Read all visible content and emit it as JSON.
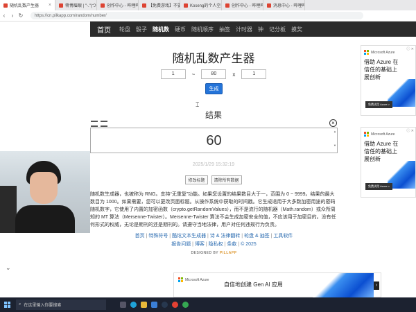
{
  "browser": {
    "tabs": [
      {
        "label": "随机乱数产生器",
        "active": true
      },
      {
        "label": "蒋博眉眼 | \"-.\"(つ`□´)~ 干杯~-bili",
        "active": false
      },
      {
        "label": "创作中心 - 哔哩哔哩弹幕视频网",
        "active": false
      },
      {
        "label": "【免费游戏】不要超过人类所有…",
        "active": false
      },
      {
        "label": "Koseng的个人空间-Koseng个人…",
        "active": false
      },
      {
        "label": "创作中心 - 哔哩哔哩弹幕视频网",
        "active": false
      },
      {
        "label": "消息中心 - 哔哩哔哩弹幕视频网",
        "active": false
      }
    ],
    "url": "https://cn.pilkapp.com/random/number/"
  },
  "nav": {
    "home": "首页",
    "items": [
      "轮盘",
      "骰子",
      "随机数",
      "硬币",
      "随机顺序",
      "抽签",
      "计时器",
      "钟",
      "记分板",
      "摸奖"
    ],
    "current": "随机数"
  },
  "main": {
    "title": "随机乱数产生器",
    "min": "1",
    "dash": "~",
    "max": "80",
    "times": "x",
    "count": "1",
    "generate_label": "生成",
    "result_title": "结果",
    "result_value": "60",
    "timestamp": "2025/1/29 15:32:19",
    "btn_edit": "修改标题",
    "btn_clear": "清除所有数据",
    "description": "随机数生成器，也被称为 RNG。支持“无重复”功能。如果您设置的结果数目大于一，范围为 0 ~ 9999。结果的最大数目为 1000。如果需要，您可以更改页面标题。从操作系统中获取的时间戳。它生成适用于大多数加密用途的密码随机数字，它使用了内置的加密函数（crypto.getRandomValues），而不是流行的随机器（Math.random）或众所周知的 MT 算法（Mersenne-Twister）。Mersenne-Twister 算法不会生成加密安全的值，不应该用于加密目的。没有任何形式的权威，无论是期刊的还是期刊的。请遵守当地法律，用户对任何违规行为负责。",
    "desc_emphasis": "Mersenne-Twister",
    "footer_links_1": [
      "首页",
      "特殊符号",
      "酷炫文本生成器",
      "诗 & 法律翻转",
      "轮盘 & 抽签",
      "工具软件"
    ],
    "footer_links_2": [
      "报告问题",
      "博客",
      "隐私权",
      "条款",
      "© 2025"
    ],
    "designed_by": "DESIGNED BY",
    "designer": "PILLAPP"
  },
  "ads": {
    "brand": "Microsoft Azure",
    "headline": "借助 Azure 在信任的基础上展创新",
    "cta": "免费试用 Azure >",
    "bottom_text": "自信地创建 Gen AI 应用"
  },
  "taskbar": {
    "search_placeholder": "在这里输入你要搜索"
  }
}
